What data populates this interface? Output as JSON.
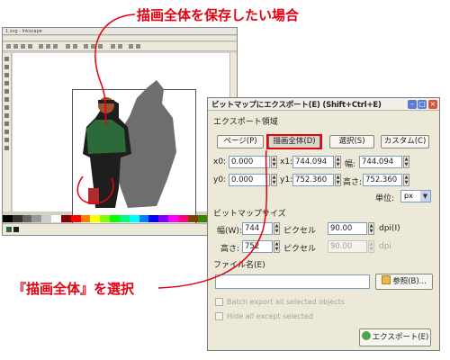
{
  "annotations": {
    "top": "描画全体を保存したい場合",
    "bottom": "『描画全体』を選択"
  },
  "colors": {
    "annotation": "#e60012"
  },
  "editor": {
    "title": "1.svg - Inkscape"
  },
  "dialog": {
    "title": "ビットマップにエクスポート(E) (Shift+Ctrl+E)",
    "export_area_label": "エクスポート領域",
    "area_buttons": [
      "ページ(P)",
      "描画全体(D)",
      "選択(S)",
      "カスタム(C)"
    ],
    "selected_area": "描画全体(D)",
    "coords": {
      "x0_label": "x0:",
      "x0": "0.000",
      "x1_label": "x1:",
      "x1": "744.094",
      "width_label": "幅:",
      "width": "744.094",
      "y0_label": "y0:",
      "y0": "0.000",
      "y1_label": "y1:",
      "y1": "752.360",
      "height_label": "高さ:",
      "height": "752.360"
    },
    "unit_label": "単位:",
    "unit_value": "px",
    "bitmap_size_label": "ビットマップサイズ",
    "bitmap": {
      "width_label": "幅(W):",
      "width": "744",
      "height_label": "高さ:",
      "height": "752",
      "pixels_at_label": "ピクセル",
      "dpi_label": "dpi(I)",
      "dpi": "90.00",
      "dpi_disabled": "90.00",
      "dpi_disabled_label": "dpi"
    },
    "filename_label": "ファイル名(E)",
    "filename_value": "",
    "browse_button": "参照(B)...",
    "batch_export_label": "Batch export all selected objects",
    "hide_except_label": "Hide all except selected",
    "export_button": "エクスポート(E)"
  }
}
